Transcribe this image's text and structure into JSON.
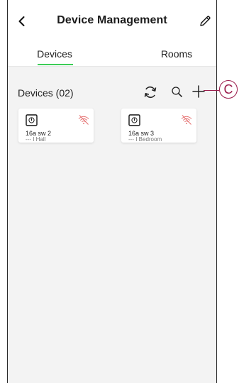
{
  "header": {
    "title": "Device Management"
  },
  "tabs": [
    {
      "label": "Devices",
      "active": true
    },
    {
      "label": "Rooms",
      "active": false
    }
  ],
  "devices_section": {
    "count_label": "Devices (02)",
    "actions": [
      {
        "icon": "refresh-icon"
      },
      {
        "icon": "search-icon"
      },
      {
        "icon": "plus-icon"
      }
    ]
  },
  "devices": [
    {
      "name": "16a sw 2",
      "room": "--- I Hall",
      "status": "offline"
    },
    {
      "name": "16a sw 3",
      "room": "--- I Bedroom",
      "status": "offline"
    }
  ],
  "callout": {
    "label": "C"
  },
  "colors": {
    "accent_green": "#3dcd58",
    "offline_red": "#e57373",
    "callout": "#9a1a4a"
  }
}
